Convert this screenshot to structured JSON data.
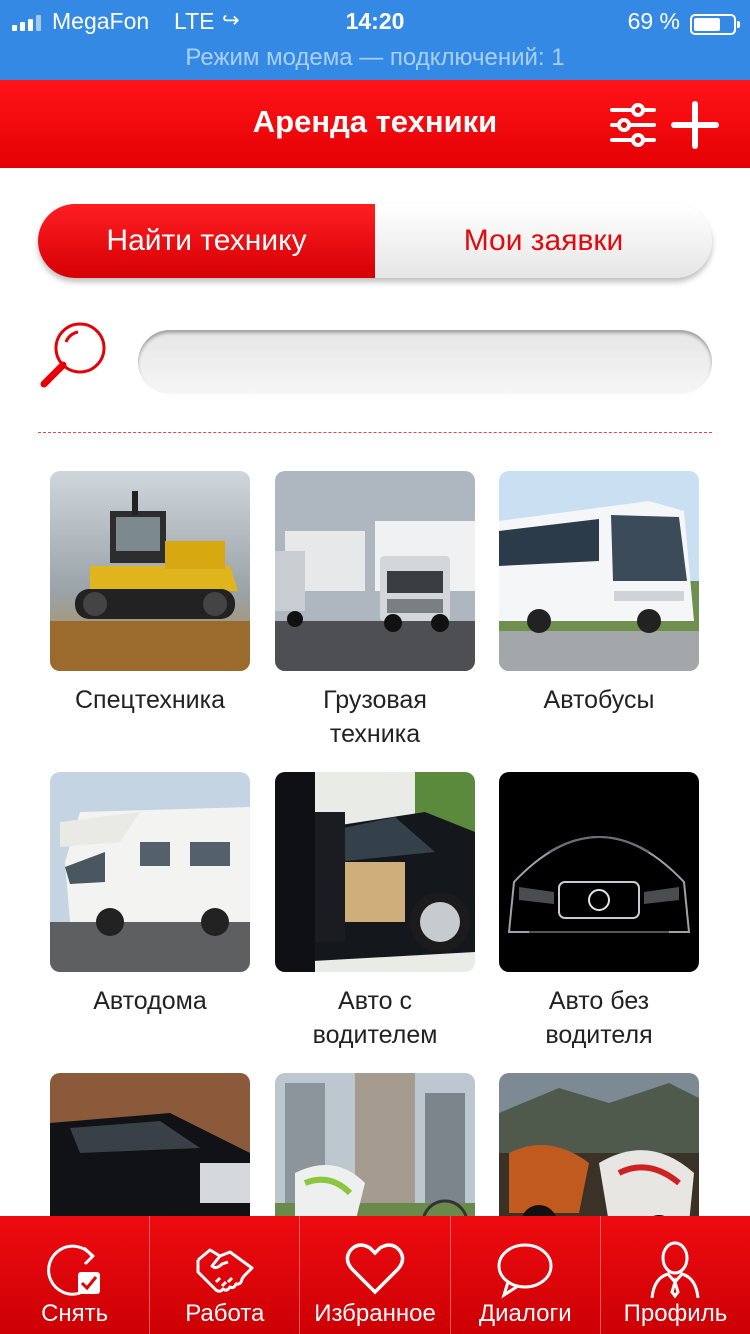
{
  "status_bar": {
    "carrier": "MegaFon",
    "network": "LTE",
    "time": "14:20",
    "battery": "69 %",
    "battery_level": 0.69,
    "hotspot": "Режим модема — подключений: 1"
  },
  "header": {
    "title": "Аренда техники",
    "filter_icon": "sliders-icon",
    "add_icon": "plus-icon"
  },
  "segment": {
    "find": "Найти технику",
    "my_requests": "Мои заявки",
    "selected": "find"
  },
  "search": {
    "value": "",
    "placeholder": "",
    "icon": "magnifier-icon"
  },
  "categories": [
    {
      "label": "Спецтехника",
      "icon": "tractor-photo"
    },
    {
      "label": "Грузовая техника",
      "icon": "truck-photo"
    },
    {
      "label": "Автобусы",
      "icon": "bus-photo"
    },
    {
      "label": "Автодома",
      "icon": "motorhome-photo"
    },
    {
      "label": "Авто с водителем",
      "icon": "chauffeur-car-photo"
    },
    {
      "label": "Авто без водителя",
      "icon": "mercedes-photo"
    },
    {
      "label": "",
      "icon": "retro-car-photo"
    },
    {
      "label": "",
      "icon": "scooter-bike-photo"
    },
    {
      "label": "",
      "icon": "motorcycles-photo"
    }
  ],
  "tabs": [
    {
      "label": "Снять",
      "icon": "refresh-check-icon"
    },
    {
      "label": "Работа",
      "icon": "handshake-icon"
    },
    {
      "label": "Избранное",
      "icon": "heart-icon"
    },
    {
      "label": "Диалоги",
      "icon": "speech-bubble-icon"
    },
    {
      "label": "Профиль",
      "icon": "person-icon"
    }
  ],
  "colors": {
    "brand_red": "#e40004",
    "status_blue": "#3389e4"
  }
}
